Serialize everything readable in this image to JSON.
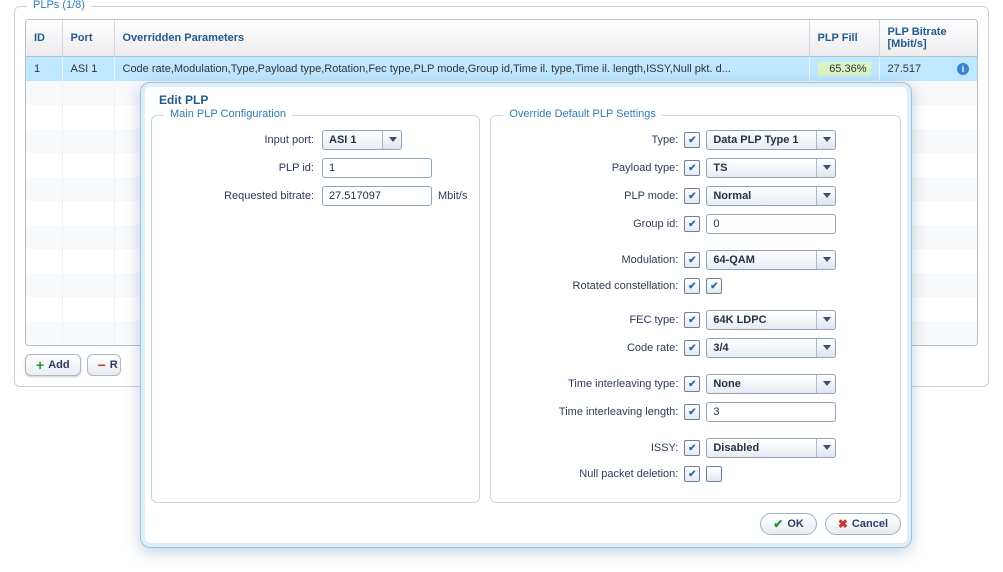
{
  "outer": {
    "title": "PLPs (1/8)"
  },
  "columns": {
    "c0": "ID",
    "c1": "Port",
    "c2": "Overridden Parameters",
    "c3": "PLP Fill",
    "c4": "PLP Bitrate [Mbit/s]"
  },
  "row": {
    "id": "1",
    "port": "ASI 1",
    "params": "Code rate,Modulation,Type,Payload type,Rotation,Fec type,PLP mode,Group id,Time il. type,Time il. length,ISSY,Null pkt. d...",
    "fill": "65.36%",
    "bitrate": "27.517"
  },
  "toolbar": {
    "add": "Add",
    "remove": "R"
  },
  "dialog": {
    "title": "Edit PLP",
    "left": {
      "title": "Main PLP Configuration",
      "labels": {
        "port": "Input port:",
        "plpid": "PLP id:",
        "reqbr": "Requested bitrate:"
      },
      "values": {
        "port": "ASI 1",
        "plpid": "1",
        "reqbr": "27.517097"
      },
      "unit": "Mbit/s"
    },
    "right": {
      "title": "Override Default PLP Settings",
      "labels": {
        "type": "Type:",
        "payload": "Payload type:",
        "mode": "PLP mode:",
        "group": "Group id:",
        "mod": "Modulation:",
        "rot": "Rotated constellation:",
        "fec": "FEC type:",
        "cr": "Code rate:",
        "tiltype": "Time interleaving type:",
        "tillen": "Time interleaving length:",
        "issy": "ISSY:",
        "nullpkt": "Null packet deletion:"
      },
      "values": {
        "type": "Data PLP Type 1",
        "payload": "TS",
        "mode": "Normal",
        "group": "0",
        "mod": "64-QAM",
        "fec": "64K LDPC",
        "cr": "3/4",
        "tiltype": "None",
        "tillen": "3",
        "issy": "Disabled"
      }
    },
    "buttons": {
      "ok": "OK",
      "cancel": "Cancel"
    }
  }
}
